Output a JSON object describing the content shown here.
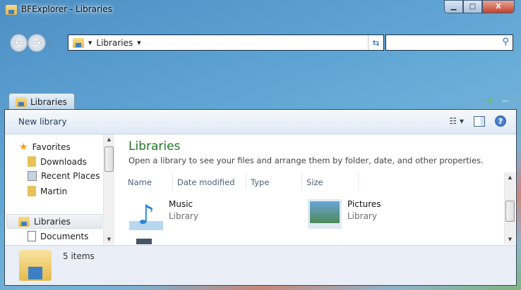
{
  "window": {
    "title": "BFExplorer - Libraries",
    "minimize": "▁",
    "maximize": "□",
    "close": "X"
  },
  "address": {
    "crumb": "Libraries",
    "search_placeholder": ""
  },
  "tabs": [
    {
      "label": "Libraries"
    }
  ],
  "toolbar": {
    "new_library": "New library"
  },
  "sidebar": {
    "favorites": "Favorites",
    "items": [
      {
        "label": "Downloads"
      },
      {
        "label": "Recent Places"
      },
      {
        "label": "Martin"
      }
    ],
    "libraries": "Libraries",
    "sub": [
      {
        "label": "Documents"
      }
    ]
  },
  "main": {
    "heading": "Libraries",
    "description": "Open a library to see your files and arrange them by folder, date, and other properties.",
    "columns": [
      "Name",
      "Date modified",
      "Type",
      "Size"
    ],
    "items": [
      {
        "name": "Music",
        "type": "Library"
      },
      {
        "name": "Pictures",
        "type": "Library"
      }
    ]
  },
  "status": {
    "count": "5 items"
  }
}
